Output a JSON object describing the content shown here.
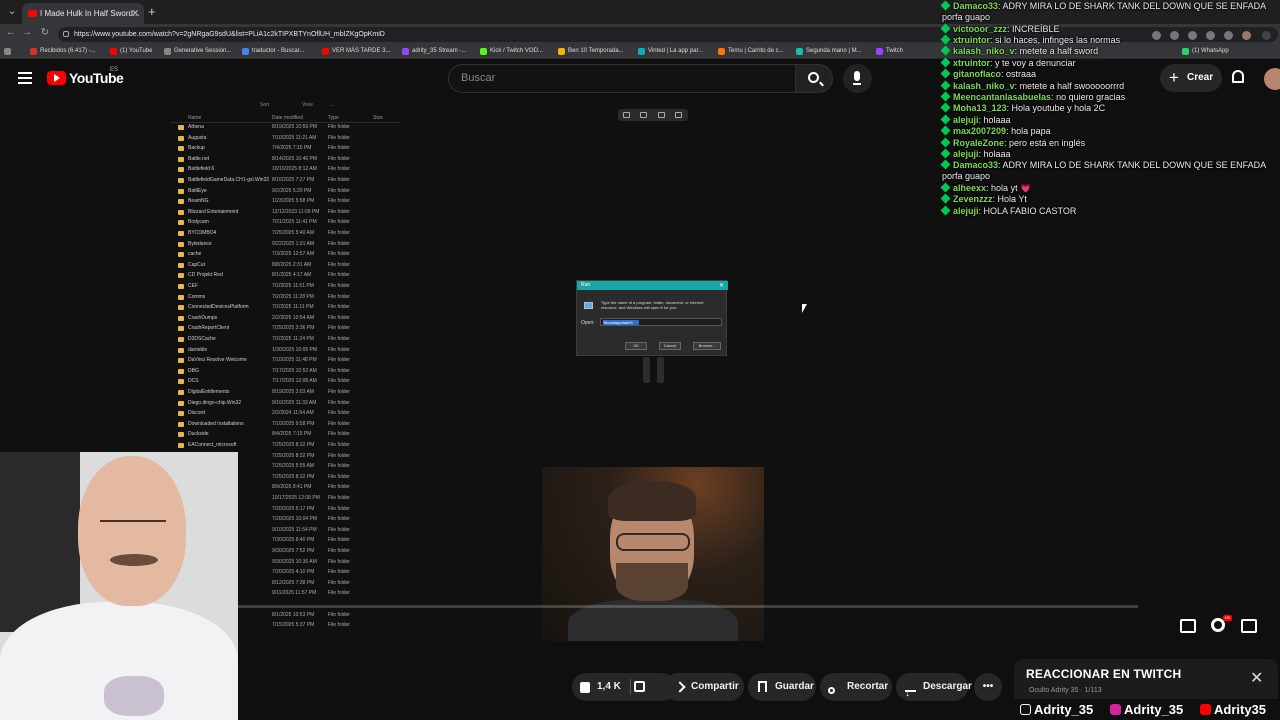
{
  "browser": {
    "tab_title": "I Made Hulk In Half Sword...",
    "url": "https://www.youtube.com/watch?v=2gNRgaG9sdU&list=PLiA1c2kTIPXBTYnOflUH_mbIZKgOpKmiD",
    "bookmarks": [
      {
        "label": "Recibidos (6.417) -...",
        "color": "#d93025"
      },
      {
        "label": "(1) YouTube",
        "color": "#ff0000"
      },
      {
        "label": "Generative Session...",
        "color": "#888888"
      },
      {
        "label": "traductor - Buscar...",
        "color": "#4285f4"
      },
      {
        "label": "VER MÁS TARDE 3...",
        "color": "#ff0000"
      },
      {
        "label": "adrity_35 Stream -...",
        "color": "#9146ff"
      },
      {
        "label": "Kick / Twitch VOD...",
        "color": "#53fc18"
      },
      {
        "label": "Ben 10 Temporada...",
        "color": "#f4b400"
      },
      {
        "label": "Vinted | La app par...",
        "color": "#09b1ba"
      },
      {
        "label": "Temu | Carrito de c...",
        "color": "#fb7701"
      },
      {
        "label": "Segunda mano | M...",
        "color": "#13c1ac"
      },
      {
        "label": "Twitch",
        "color": "#9146ff"
      },
      {
        "label": "(1) WhatsApp",
        "color": "#25d366"
      }
    ]
  },
  "header": {
    "logo_text": "YouTube",
    "country": "ES",
    "search_placeholder": "Buscar",
    "create_label": "Crear"
  },
  "explorer": {
    "toolbar": [
      "Sort",
      "View",
      "..."
    ],
    "columns": [
      "Name",
      "Date modified",
      "Type",
      "Size"
    ],
    "rows": [
      {
        "name": "Athena",
        "date": "8/19/2025 10:59 PM",
        "type": "File folder"
      },
      {
        "name": "Augusta",
        "date": "7/10/2025 11:21 AM",
        "type": "File folder"
      },
      {
        "name": "Backup",
        "date": "7/4/2025 7:15 PM",
        "type": "File folder"
      },
      {
        "name": "Battle.net",
        "date": "8/14/2025 10:46 PM",
        "type": "File folder"
      },
      {
        "name": "Battlefield 6",
        "date": "10/10/2025 8:12 AM",
        "type": "File folder"
      },
      {
        "name": "BattlefieldGameData.CH1-gxl.Win32",
        "date": "8/16/2025 7:27 PM",
        "type": "File folder"
      },
      {
        "name": "BattlEye",
        "date": "9/2/2025 5:20 PM",
        "type": "File folder"
      },
      {
        "name": "BeamNG",
        "date": "1/23/2025 5:58 PM",
        "type": "File folder"
      },
      {
        "name": "Blizzard Entertainment",
        "date": "12/12/2023 11:09 PM",
        "type": "File folder"
      },
      {
        "name": "Bodycam",
        "date": "7/21/2025 11:41 PM",
        "type": "File folder"
      },
      {
        "name": "BYCOMBO4",
        "date": "7/25/2025 5:40 AM",
        "type": "File folder"
      },
      {
        "name": "Bytedance",
        "date": "9/22/2025 1:01 AM",
        "type": "File folder"
      },
      {
        "name": "cache",
        "date": "7/3/2025 12:57 AM",
        "type": "File folder"
      },
      {
        "name": "CapCut",
        "date": "8/8/2025 2:31 AM",
        "type": "File folder"
      },
      {
        "name": "CD Projekt Red",
        "date": "8/1/2025 4:17 AM",
        "type": "File folder"
      },
      {
        "name": "CEF",
        "date": "7/2/2025 11:51 PM",
        "type": "File folder"
      },
      {
        "name": "Comms",
        "date": "7/2/2025 11:28 PM",
        "type": "File folder"
      },
      {
        "name": "ConnectedDevicesPlatform",
        "date": "7/2/2025 11:11 PM",
        "type": "File folder"
      },
      {
        "name": "CrashDumps",
        "date": "2/2/2025 10:54 AM",
        "type": "File folder"
      },
      {
        "name": "CrashReportClient",
        "date": "7/25/2025 3:36 PM",
        "type": "File folder"
      },
      {
        "name": "D3DSCache",
        "date": "7/2/2025 11:24 PM",
        "type": "File folder"
      },
      {
        "name": "danteble",
        "date": "1/30/2025 10:05 PM",
        "type": "File folder"
      },
      {
        "name": "DaVinci Resolve Welcome",
        "date": "7/10/2025 11:48 PM",
        "type": "File folder"
      },
      {
        "name": "DBG",
        "date": "7/17/2025 10:52 AM",
        "type": "File folder"
      },
      {
        "name": "DCS",
        "date": "7/17/2025 12:08 AM",
        "type": "File folder"
      },
      {
        "name": "DigitalEntitlements",
        "date": "8/19/2025 3:03 AM",
        "type": "File folder"
      },
      {
        "name": "Diego.dingo-chip.Win32",
        "date": "9/16/2025 11:33 AM",
        "type": "File folder"
      },
      {
        "name": "Discord",
        "date": "2/2/2024 11:54 AM",
        "type": "File folder"
      },
      {
        "name": "Downloaded Installations",
        "date": "7/10/2025 9:58 PM",
        "type": "File folder"
      },
      {
        "name": "Duckside",
        "date": "8/4/2025 7:15 PM",
        "type": "File folder"
      },
      {
        "name": "EAConnect_microsoft",
        "date": "7/25/2025 8:32 PM",
        "type": "File folder"
      },
      {
        "name": "EADesktop",
        "date": "7/25/2025 8:32 PM",
        "type": "File folder"
      },
      {
        "name": "EALaunchHelper",
        "date": "7/25/2025 5:55 AM",
        "type": "File folder"
      },
      {
        "name": "Electronic Arts",
        "date": "7/25/2025 8:32 PM",
        "type": "File folder"
      },
      {
        "name": "Elgato",
        "date": "8/9/2025 8:41 PM",
        "type": "File folder"
      },
      {
        "name": "Embark",
        "date": "10/17/2025 12:08 PM",
        "type": "File folder"
      },
      {
        "name": "Epic Games",
        "date": "7/20/2025 5:17 PM",
        "type": "File folder"
      },
      {
        "name": "EpicGamesLauncher",
        "date": "7/20/2025 10:04 PM",
        "type": "File folder"
      },
      {
        "name": "FabPlugins",
        "date": "9/10/2025 11:54 PM",
        "type": "File folder"
      },
      {
        "name": "firebase-heartbeat",
        "date": "7/30/2025 8:40 PM",
        "type": "File folder"
      },
      {
        "name": "fontconfig",
        "date": "9/30/2025 7:52 PM",
        "type": "File folder"
      },
      {
        "name": "FortniteGame",
        "date": "9/30/2025 10:36 AM",
        "type": "File folder"
      },
      {
        "name": "Gaijin",
        "date": "7/20/2025 4:10 PM",
        "type": "File folder"
      },
      {
        "name": "GameAnalytics",
        "date": "8/12/2025 7:38 PM",
        "type": "File folder"
      },
      {
        "name": "g-menu-updater",
        "date": "9/11/2025 11:57 PM",
        "type": "File folder"
      },
      {
        "name": "",
        "date": "",
        "type": ""
      },
      {
        "name": "",
        "date": "8/1/2025 10:53 PM",
        "type": "File folder"
      },
      {
        "name": "",
        "date": "7/15/2025 5:37 PM",
        "type": "File folder"
      }
    ]
  },
  "run_dialog": {
    "title": "Run",
    "description": "Type the name of a program, folder, document, or Internet resource, and Windows will open it for you.",
    "open_label": "Open:",
    "input_value": "%localappdata%",
    "ok": "OK",
    "cancel": "Cancel",
    "browse": "Browse..."
  },
  "player": {
    "progress_fraction": 0.05,
    "hd_badge": "HD"
  },
  "actions": {
    "likes": "1,4 K",
    "share": "Compartir",
    "save": "Guardar",
    "clip": "Recortar",
    "download": "Descargar",
    "more": "•••"
  },
  "chat": [
    {
      "user": "Damaco33",
      "message": "ADRY MIRA LO DE SHARK TANK DEL DOWN QUE SE ENFADA porfa guapo"
    },
    {
      "user": "victooor_zzz",
      "message": "INCREÍBLE"
    },
    {
      "user": "xtruintor",
      "message": "si lo haces, infinges las normas"
    },
    {
      "user": "kalash_niko_v",
      "message": "metete a half sword"
    },
    {
      "user": "xtruintor",
      "message": "y te voy a denunciar"
    },
    {
      "user": "gitanoflaco",
      "message": "ostraaa"
    },
    {
      "user": "kalash_niko_v",
      "message": "metete a half swooooorrrd"
    },
    {
      "user": "Meencantanlasabuelas",
      "message": "no quiero gracias"
    },
    {
      "user": "Moha13_123",
      "message": "Hola youtube y hola 2C"
    },
    {
      "user": "alejuji",
      "message": "holaaa"
    },
    {
      "user": "max2007209",
      "message": "hola papa"
    },
    {
      "user": "RoyaleZone",
      "message": "pero está en inglés"
    },
    {
      "user": "alejuji",
      "message": "holaaa"
    },
    {
      "user": "Damaco33",
      "message": "ADRY MIRA LO DE SHARK TANK DEL DOWN QUE SE ENFADA porfa guapo"
    },
    {
      "user": "alheexx",
      "message": "hola yt 💗"
    },
    {
      "user": "Zevenzzz",
      "message": "Hola Yt"
    },
    {
      "user": "alejuji",
      "message": "HOLA FABIO CASTOR"
    }
  ],
  "react_card": {
    "title": "REACCIONAR EN TWITCH",
    "subtitle": "Oculto Adrity 35 · 1/113",
    "close": "✕"
  },
  "socials": [
    {
      "label": "Adrity_35",
      "icon": "tiktok-icon",
      "color": "#111111"
    },
    {
      "label": "Adrity_35",
      "icon": "instagram-icon",
      "color": "#d6249f"
    },
    {
      "label": "Adrity35",
      "icon": "youtube-icon",
      "color": "#ff0000"
    }
  ]
}
